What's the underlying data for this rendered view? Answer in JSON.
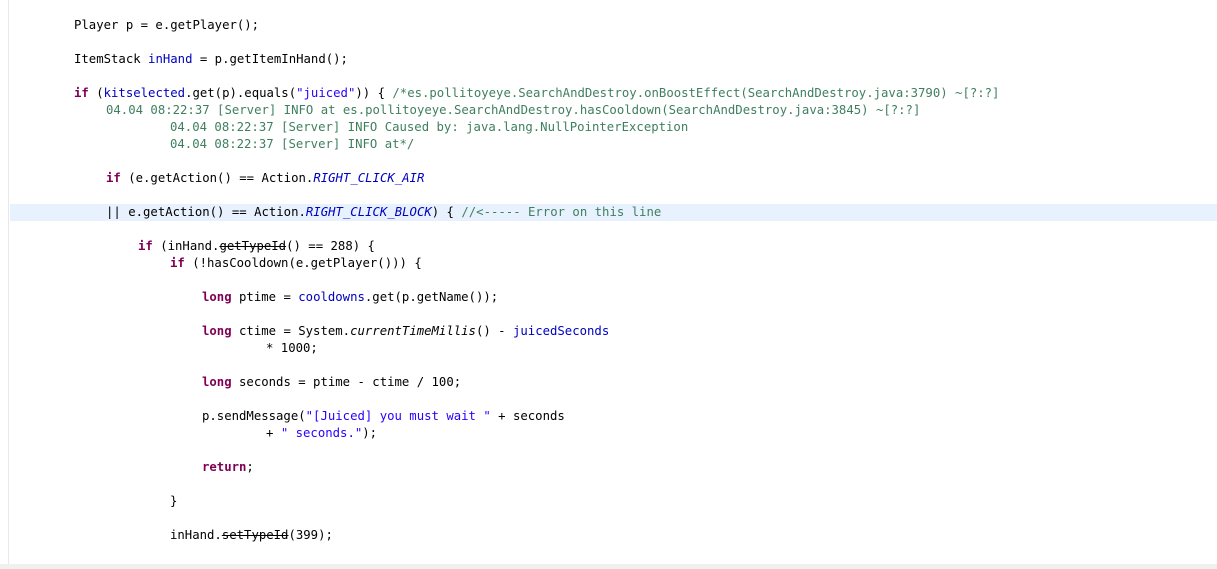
{
  "editor": {
    "lines": [
      [
        {
          "t": "Player p = e.getPlayer();"
        }
      ],
      [
        {
          "t": "ItemStack "
        },
        {
          "t": "inHand",
          "c": "fld"
        },
        {
          "t": " = p.getItemInHand();"
        }
      ],
      [
        {
          "t": "if",
          "c": "kw"
        },
        {
          "t": " ("
        },
        {
          "t": "kitselected",
          "c": "fld"
        },
        {
          "t": ".get(p).equals("
        },
        {
          "t": "\"juiced\"",
          "c": "str"
        },
        {
          "t": ")) { "
        },
        {
          "t": "/*es.pollitoyeye.SearchAndDestroy.onBoostEffect(SearchAndDestroy.java:3790) ~[?:?]",
          "c": "cmt"
        }
      ],
      [
        {
          "t": "04.04 08:22:37 [Server] INFO at es.pollitoyeye.SearchAndDestroy.hasCooldown(SearchAndDestroy.java:3845) ~[?:?]",
          "c": "cmt"
        }
      ],
      [
        {
          "t": "04.04 08:22:37 [Server] INFO Caused by: java.lang.NullPointerException",
          "c": "cmt"
        }
      ],
      [
        {
          "t": "04.04 08:22:37 [Server] INFO at*/",
          "c": "cmt"
        }
      ],
      [
        {
          "t": "if",
          "c": "kw"
        },
        {
          "t": " (e.getAction() == Action."
        },
        {
          "t": "RIGHT_CLICK_AIR",
          "c": "const"
        }
      ],
      [
        {
          "t": "|| e.getAction() == Action."
        },
        {
          "t": "RIGHT_CLICK_BLOCK",
          "c": "const"
        },
        {
          "t": ") { "
        },
        {
          "t": "//<----- Error on this line",
          "c": "cmt"
        }
      ],
      [
        {
          "t": "if",
          "c": "kw"
        },
        {
          "t": " (inHand."
        },
        {
          "t": "getTypeId",
          "c": "dep"
        },
        {
          "t": "() == 288) {"
        }
      ],
      [
        {
          "t": "if",
          "c": "kw"
        },
        {
          "t": " (!hasCooldown(e.getPlayer())) {"
        }
      ],
      [
        {
          "t": "long",
          "c": "kw"
        },
        {
          "t": " ptime = "
        },
        {
          "t": "cooldowns",
          "c": "fld"
        },
        {
          "t": ".get(p.getName());"
        }
      ],
      [
        {
          "t": "long",
          "c": "kw"
        },
        {
          "t": " ctime = System."
        },
        {
          "t": "currentTimeMillis",
          "c": "stat"
        },
        {
          "t": "() - "
        },
        {
          "t": "juicedSeconds",
          "c": "fld"
        }
      ],
      [
        {
          "t": "* 1000;"
        }
      ],
      [
        {
          "t": "long",
          "c": "kw"
        },
        {
          "t": " seconds = ptime - ctime / 100;"
        }
      ],
      [
        {
          "t": "p.sendMessage("
        },
        {
          "t": "\"[Juiced] you must wait \"",
          "c": "str"
        },
        {
          "t": " + seconds"
        }
      ],
      [
        {
          "t": "+ "
        },
        {
          "t": "\" seconds.\"",
          "c": "str"
        },
        {
          "t": ");"
        }
      ],
      [
        {
          "t": "return",
          "c": "kw"
        },
        {
          "t": ";"
        }
      ],
      [
        {
          "t": "}"
        }
      ],
      [
        {
          "t": "inHand.",
          "c": ""
        },
        {
          "t": "setTypeId",
          "c": "dep"
        },
        {
          "t": "(399);"
        }
      ]
    ]
  },
  "colors": {
    "keyword": "#7f0055",
    "field": "#0000c0",
    "string": "#2a00ff",
    "comment": "#3f7f5f",
    "current_line": "#e8f2fe"
  }
}
